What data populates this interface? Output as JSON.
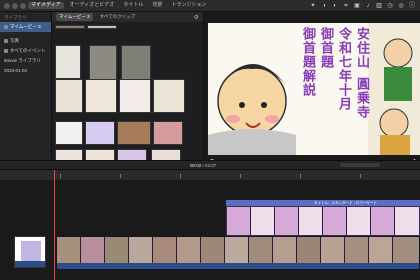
{
  "app": {
    "top_tabs": [
      "マイメディア",
      "オーディオとビデオ",
      "タイトル",
      "背景",
      "トランジション"
    ]
  },
  "sidebar": {
    "section_head": "ライブラリ",
    "items": [
      {
        "label": "マイムービー 3",
        "selected": true
      },
      {
        "label": "写真",
        "selected": false
      },
      {
        "label": "すべてのイベント",
        "selected": false
      },
      {
        "label": "iMovie ライブラリ",
        "selected": false
      },
      {
        "label": "2023-01-04",
        "selected": false
      }
    ]
  },
  "browser": {
    "tabs": [
      "マイムービー 3",
      "すべてのクリップ"
    ],
    "settings_icon": "gear-icon"
  },
  "viewer": {
    "text_lines": [
      "安住山",
      "圓乗寺",
      "令和七年十月",
      "御首題",
      "御首題解説"
    ],
    "controls": {
      "mic": "microphone-icon",
      "prev": "previous-icon",
      "play": "play-icon",
      "next": "next-icon",
      "fullscreen": "fullscreen-icon"
    }
  },
  "timeline": {
    "timecode_current": "00:02",
    "timecode_total": "02:07",
    "title_clip_label": "タイトル：スタンダード・ロワーサード"
  },
  "colors": {
    "accent": "#3f5f8a",
    "title_clip": "#5a6fc4",
    "clip_purple": "#7c5aa8",
    "audio": "#2b4d8a",
    "playhead": "#e94a3e"
  }
}
